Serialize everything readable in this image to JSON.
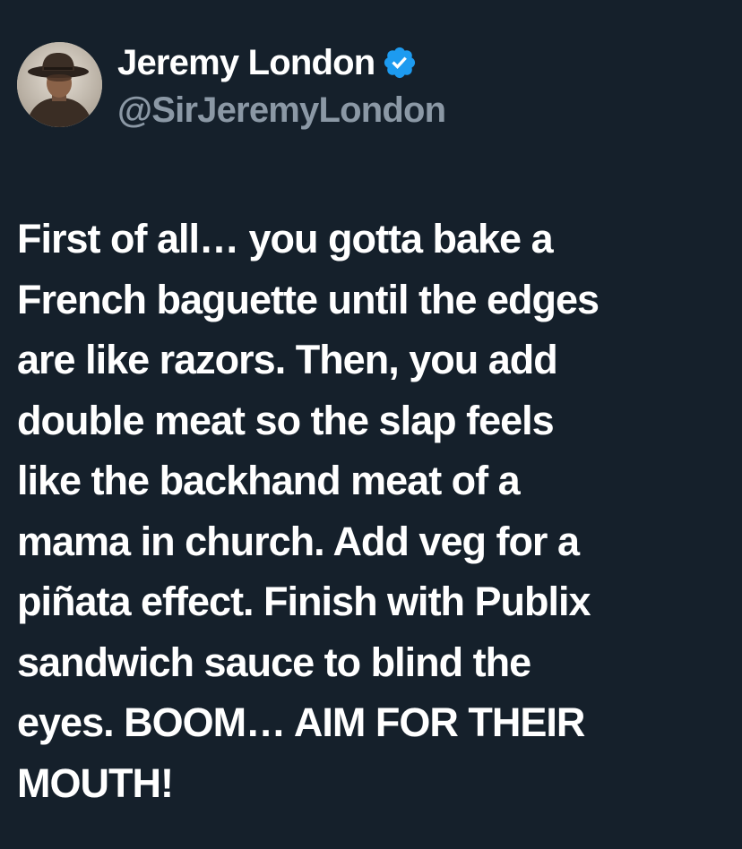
{
  "author": {
    "display_name": "Jeremy London",
    "handle": "@SirJeremyLondon",
    "verified": true,
    "verified_color": "#1d9bf0",
    "avatar_icon": "avatar-cowboy-hat"
  },
  "tweet": {
    "text": "First of all… you gotta bake a\nFrench baguette until the edges\nare like razors. Then, you add\ndouble meat so the slap feels\nlike the backhand meat of a\nmama in church. Add veg for a\npiñata effect. Finish with Publix\nsandwich sauce to blind the\neyes. BOOM… AIM FOR THEIR\nMOUTH!"
  },
  "colors": {
    "background": "#15202b",
    "text_primary": "#ffffff",
    "text_secondary": "#8b98a5"
  }
}
